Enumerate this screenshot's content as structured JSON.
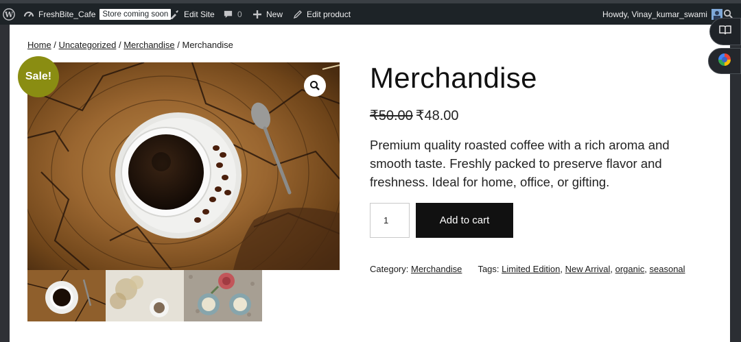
{
  "adminbar": {
    "site_name": "FreshBite_Cafe",
    "store_badge": "Store coming soon",
    "edit_site": "Edit Site",
    "comments_count": "0",
    "new_label": "New",
    "edit_product": "Edit product",
    "howdy": "Howdy, Vinay_kumar_swami"
  },
  "breadcrumb": {
    "home": "Home",
    "sep": " / ",
    "uncategorized": "Uncategorized",
    "merchandise_link": "Merchandise",
    "current": "Merchandise"
  },
  "product": {
    "sale_badge": "Sale!",
    "title": "Merchandise",
    "old_price": "₹50.00",
    "new_price": "₹48.00",
    "description": "Premium quality roasted coffee with a rich aroma and smooth taste. Freshly packed to preserve flavor and freshness. Ideal for home, office, or gifting.",
    "quantity": "1",
    "add_to_cart": "Add to cart",
    "category_label": "Category: ",
    "category": "Merchandise",
    "tags_label": "Tags: ",
    "tags": [
      "Limited Edition",
      "New Arrival",
      "organic",
      "seasonal"
    ]
  },
  "colors": {
    "adminbar_bg": "#1d2327",
    "sale_badge": "#8a8d12",
    "button_bg": "#111111"
  }
}
